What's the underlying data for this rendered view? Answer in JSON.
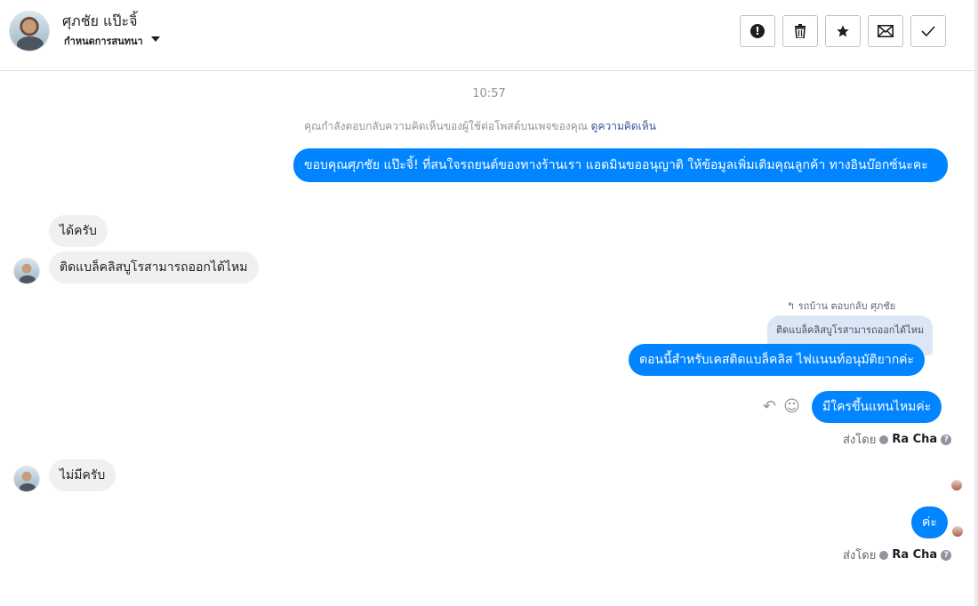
{
  "header": {
    "name": "ศุภชัย แป๊ะจิ้",
    "assign_label": "กำหนดการสนทนา",
    "tools": [
      {
        "name": "alert-button",
        "icon": "exclamation-circle-icon",
        "glyph": "!"
      },
      {
        "name": "delete-button",
        "icon": "trash-icon",
        "glyph": "🗑"
      },
      {
        "name": "star-button",
        "icon": "star-icon",
        "glyph": "★"
      },
      {
        "name": "mail-button",
        "icon": "envelope-icon",
        "glyph": "✉"
      },
      {
        "name": "done-button",
        "icon": "check-icon",
        "glyph": "✓"
      }
    ]
  },
  "chat": {
    "time": "10:57",
    "notice_text": "คุณกำลังตอบกลับความคิดเห็นของผู้ใช้ต่อโพสต์บนเพจของคุณ",
    "notice_link": "ดูความคิดเห็น",
    "messages": {
      "m1": "ขอบคุณศุภชัย แป๊ะจิ้! ที่สนใจรถยนต์ของทางร้านเรา แอดมินขออนุญาติ ให้ข้อมูลเพิ่มเติมคุณลูกค้า ทางอินบ๊อกซ์นะคะ",
      "m2": "ได้ครับ",
      "m3": "ติดแบล็คลิสบูโรสามารถออกได้ไหม",
      "reply_meta": "รถบ้าน ตอบกลับ ศุภชัย",
      "quoted": "ติดแบล็คลิสบูโรสามารถออกได้ไหม",
      "m4": "ตอนนี้สำหรับเคสติดแบล็คลิส ไฟแนนท์อนุมัติยากค่ะ",
      "m5": "มีใครขึ้นแทนไหมค่ะ",
      "m6": "ไม่มีครับ",
      "m7": "ค่ะ"
    },
    "sent_by_label": "ส่งโดย",
    "sent_by_name": "Ra Cha",
    "help_glyph": "?"
  }
}
